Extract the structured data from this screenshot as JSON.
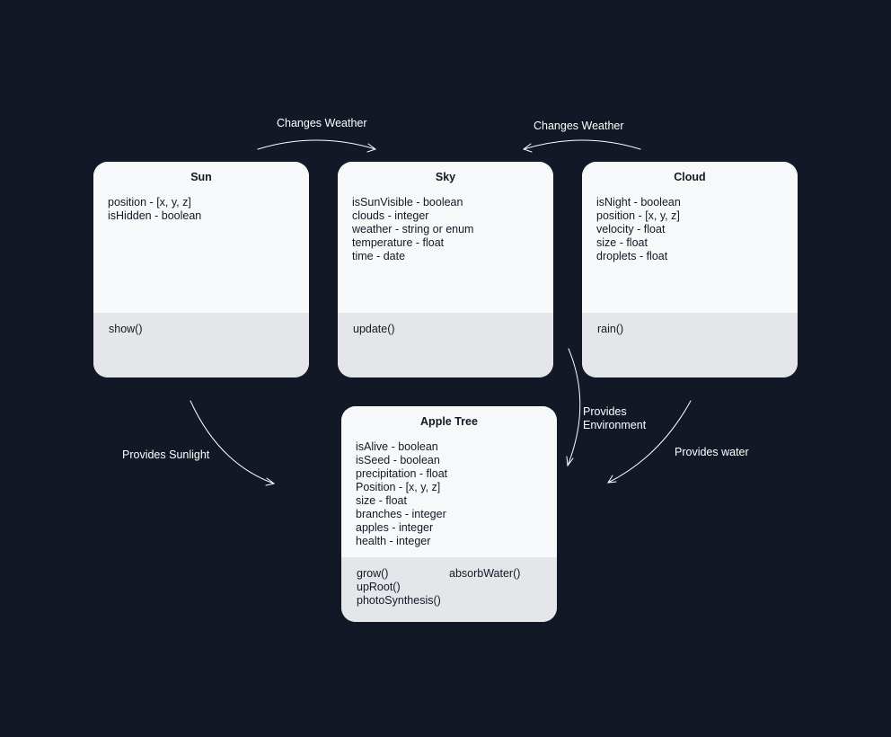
{
  "colors": {
    "background": "#121826",
    "card_top": "#F7F8FA",
    "card_bottom": "#E5E6EA",
    "text": "#121826",
    "arrow": "#FFFFFF"
  },
  "classes": {
    "sun": {
      "title": "Sun",
      "attributes": [
        "position - [x, y, z]",
        "isHidden - boolean"
      ],
      "methods": [
        "show()"
      ]
    },
    "sky": {
      "title": "Sky",
      "attributes": [
        "isSunVisible - boolean",
        "clouds - integer",
        "weather - string or enum",
        "temperature - float",
        "time - date"
      ],
      "methods": [
        "update()"
      ]
    },
    "cloud": {
      "title": "Cloud",
      "attributes": [
        "isNight - boolean",
        "position - [x, y, z]",
        "velocity - float",
        "size - float",
        "droplets - float"
      ],
      "methods": [
        "rain()"
      ]
    },
    "apple_tree": {
      "title": "Apple Tree",
      "attributes": [
        "isAlive - boolean",
        "isSeed - boolean",
        "precipitation - float",
        "Position - [x, y, z]",
        "size - float",
        "branches - integer",
        "apples - integer",
        "health - integer"
      ],
      "methods": [
        "grow()",
        "upRoot()",
        "photoSynthesis()"
      ],
      "methods_col2": [
        "absorbWater()"
      ]
    }
  },
  "relations": {
    "sun_to_sky": "Changes Weather",
    "cloud_to_sky": "Changes Weather",
    "sun_to_tree": "Provides Sunlight",
    "sky_to_tree_line1": "Provides",
    "sky_to_tree_line2": "Environment",
    "cloud_to_tree": "Provides water"
  }
}
